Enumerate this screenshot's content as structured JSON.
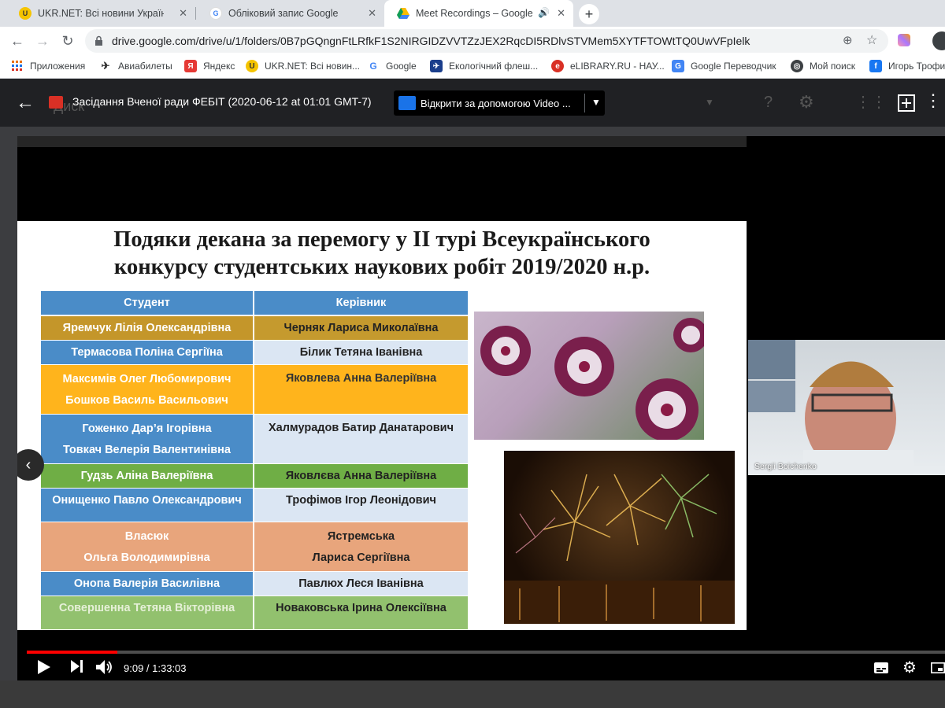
{
  "browser": {
    "tabs": [
      {
        "title": "UKR.NET: Всі новини України, ос",
        "active": false,
        "favicon": "ukrnet-icon"
      },
      {
        "title": "Обліковий запис Google",
        "active": false,
        "favicon": "google-icon"
      },
      {
        "title": "Meet Recordings – Google Д",
        "active": true,
        "favicon": "drive-icon"
      }
    ],
    "new_tab": "+",
    "url": "drive.google.com/drive/u/1/folders/0B7pGQngnFtLRfkF1S2NIRGIDZVVTZzJEX2RqcDI5RDlvSTVMem5XYTFTOWtTQ0UwVFpIelk",
    "bookmarks": [
      {
        "label": "Приложения",
        "icon": "apps-grid-icon"
      },
      {
        "label": "Авиабилеты",
        "icon": "plane-icon"
      },
      {
        "label": "Яндекс",
        "icon": "yandex-icon"
      },
      {
        "label": "UKR.NET: Всі новин...",
        "icon": "ukrnet-icon"
      },
      {
        "label": "Google",
        "icon": "google-icon"
      },
      {
        "label": "Екологічний флеш...",
        "icon": "airplane-blue-icon"
      },
      {
        "label": "eLIBRARY.RU - НАУ...",
        "icon": "elibrary-icon"
      },
      {
        "label": "Google Переводчик",
        "icon": "translate-icon"
      },
      {
        "label": "Мой поиск",
        "icon": "globe-icon"
      },
      {
        "label": "Игорь Трофи",
        "icon": "facebook-icon"
      }
    ]
  },
  "viewer": {
    "file_title": "Засідання Вченої ради ФЕБІТ (2020-06-12 at 01:01 GMT-7)",
    "open_with": "Відкрити за допомогою Video ...",
    "bg_logo_text": "Диск"
  },
  "slide": {
    "title_line1": "Подяки декана за перемогу у ІІ турі Всеукраїнського",
    "title_line2": "конкурсу студентських наукових робіт 2019/2020 н.р.",
    "headers": [
      "Студент",
      "Керівник"
    ],
    "rows": [
      {
        "students": [
          "Яремчук Лілія Олександрівна"
        ],
        "supervisor": [
          "Черняк Лариса Миколаївна"
        ]
      },
      {
        "students": [
          "Термасова Поліна Сергіїна"
        ],
        "supervisor": [
          "Білик Тетяна Іванівна"
        ]
      },
      {
        "students": [
          "Максимів Олег Любомирович",
          "Бошков Василь Васильович"
        ],
        "supervisor": [
          "Яковлева Анна Валеріївна"
        ]
      },
      {
        "students": [
          "Гоженко Дар’я Ігорівна",
          "Товкач Велерія Валентинівна"
        ],
        "supervisor": [
          "Халмурадов Батир Данатарович"
        ]
      },
      {
        "students": [
          "Гудзь Аліна Валеріївна"
        ],
        "supervisor": [
          "Яковлєва Анна Валеріївна"
        ]
      },
      {
        "students": [
          "Онищенко Павло Олександрович"
        ],
        "supervisor": [
          "Трофімов Ігор Леонідович"
        ]
      },
      {
        "students": [
          "Власюк",
          "Ольга Володимирівна"
        ],
        "supervisor": [
          "Ястремська",
          "Лариса Сергіївна"
        ]
      },
      {
        "students": [
          "Онопа Валерія Василівна"
        ],
        "supervisor": [
          "Павлюх Леся Іванівна"
        ]
      },
      {
        "students": [
          "Совершенна Тетяна Вікторівна"
        ],
        "supervisor": [
          "Новаковська Ірина Олексіївна"
        ]
      }
    ]
  },
  "participant": {
    "name": "Sergii Boichenko"
  },
  "player": {
    "current_time": "9:09",
    "duration": "1:33:03",
    "time_display": "9:09 / 1:33:03",
    "progress_fraction": 0.0982
  },
  "colors": {
    "progress": "#ff0000",
    "header_blue": "#4a8cc8"
  }
}
